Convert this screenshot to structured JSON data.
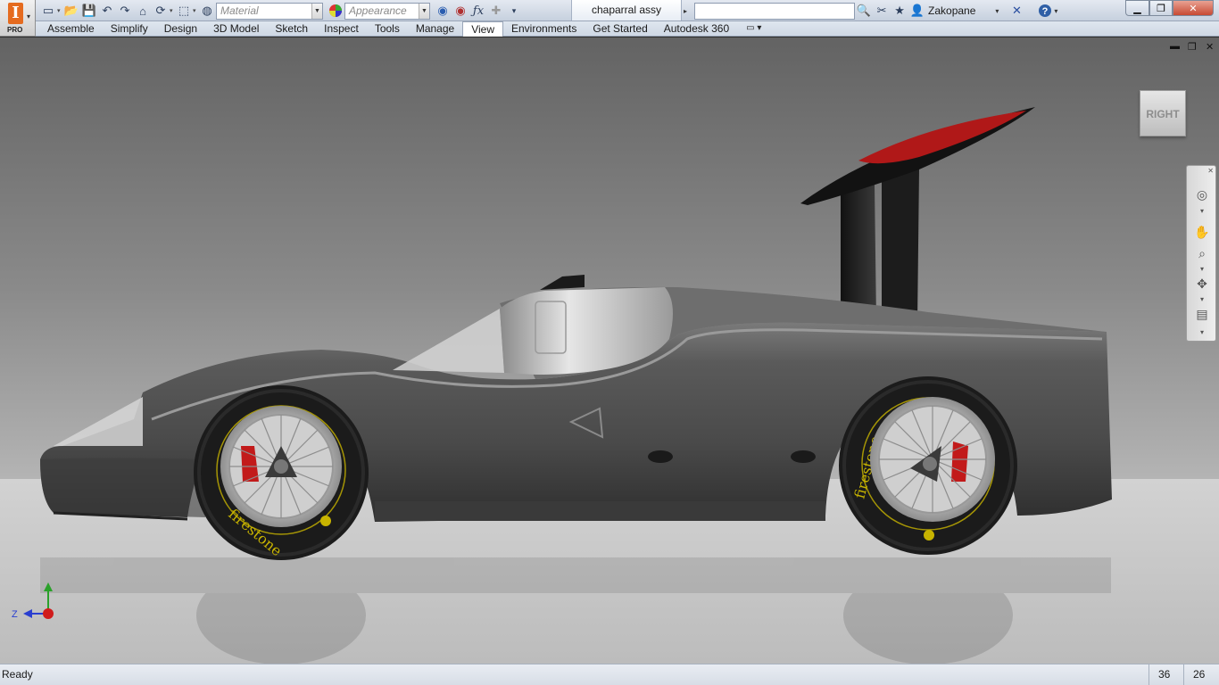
{
  "app": {
    "pro_label": "PRO",
    "document_title": "chaparral assy",
    "user_name": "Zakopane"
  },
  "quick_access": {
    "material_placeholder": "Material",
    "appearance_placeholder": "Appearance"
  },
  "ribbon": {
    "tabs": [
      {
        "label": "Assemble"
      },
      {
        "label": "Simplify"
      },
      {
        "label": "Design"
      },
      {
        "label": "3D Model"
      },
      {
        "label": "Sketch"
      },
      {
        "label": "Inspect"
      },
      {
        "label": "Tools"
      },
      {
        "label": "Manage"
      },
      {
        "label": "View",
        "active": true
      },
      {
        "label": "Environments"
      },
      {
        "label": "Get Started"
      },
      {
        "label": "Autodesk 360"
      }
    ]
  },
  "viewport": {
    "viewcube_face": "RIGHT",
    "axis_z": "Z",
    "tire_brand": "firestone",
    "colors": {
      "body": "#4a4a4a",
      "wing_accent": "#b01818",
      "tire_lettering": "#c8b400",
      "caliper": "#c21a1a"
    }
  },
  "status": {
    "text": "Ready",
    "count_a": "36",
    "count_b": "26"
  }
}
